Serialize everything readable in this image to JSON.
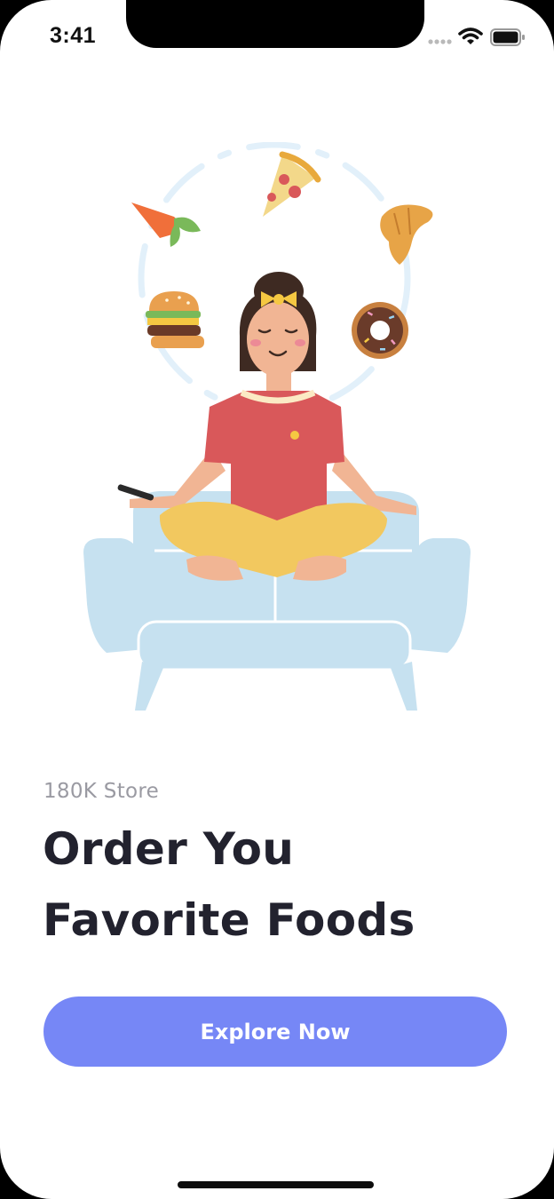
{
  "status_bar": {
    "time": "3:41",
    "icons": [
      "signal-dots-icon",
      "wifi-icon",
      "battery-icon"
    ]
  },
  "illustration": {
    "subject": "woman-meditating-on-sofa-with-food",
    "food_icons": [
      "pizza-slice-icon",
      "carrot-icon",
      "croissant-icon",
      "burger-icon",
      "donut-icon"
    ]
  },
  "onboarding": {
    "subtitle": "180K Store",
    "headline_line1": "Order You",
    "headline_line2": "Favorite Foods",
    "cta_label": "Explore Now"
  },
  "colors": {
    "accent": "#7687F6",
    "headline": "#22222E",
    "subtitle": "#9A9AA2",
    "background": "#FFFFFF"
  }
}
